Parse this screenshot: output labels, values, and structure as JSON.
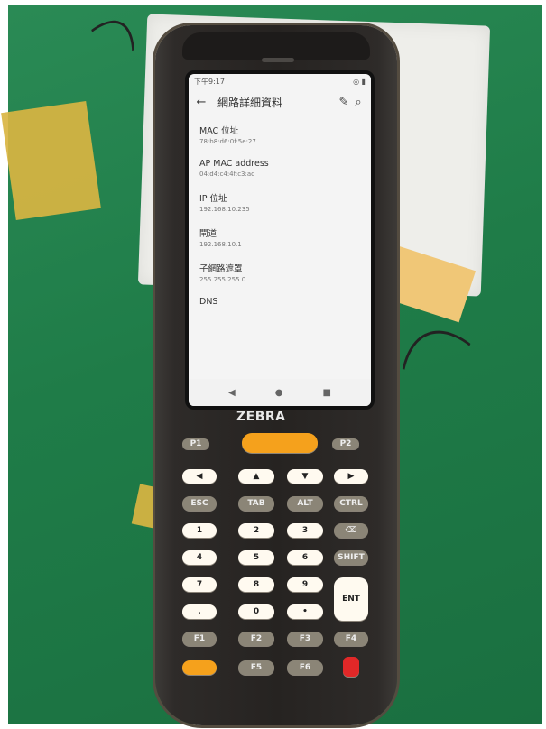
{
  "device": {
    "brand": "ZEBRA",
    "status_time": "下午9:17",
    "app_title": "網路詳細資料",
    "icons": {
      "back": "arrow-left-icon",
      "edit": "pencil-icon",
      "search": "search-icon",
      "nav_back": "triangle-left-icon",
      "nav_home": "circle-icon",
      "nav_recent": "square-icon"
    },
    "details": [
      {
        "label": "MAC 位址",
        "value": "78:b8:d6:0f:5e:27"
      },
      {
        "label": "AP MAC address",
        "value": "04:d4:c4:4f:c3:ac"
      },
      {
        "label": "IP 位址",
        "value": "192.168.10.235"
      },
      {
        "label": "閘道",
        "value": "192.168.10.1"
      },
      {
        "label": "子網路遮罩",
        "value": "255.255.255.0"
      },
      {
        "label": "DNS",
        "value": ""
      }
    ],
    "keypad": {
      "row1": [
        "P1",
        "",
        "P2"
      ],
      "row2": [
        "◀",
        "▲",
        "▼",
        "▶"
      ],
      "row3": [
        "ESC",
        "TAB",
        "ALT",
        "CTRL"
      ],
      "row4": [
        "1",
        "2",
        "3",
        "⌫"
      ],
      "row5": [
        "4",
        "5",
        "6",
        "SHIFT"
      ],
      "row6": [
        "7",
        "8",
        "9",
        "ENT"
      ],
      "row7": [
        ".",
        "0",
        "•"
      ],
      "row8": [
        "F1",
        "F2",
        "F3",
        "F4"
      ],
      "row9": [
        "",
        "F5",
        "F6",
        ""
      ]
    },
    "colors": {
      "accent": "#f5a11c",
      "danger": "#e12828",
      "screen": "#f4f4f4"
    }
  }
}
